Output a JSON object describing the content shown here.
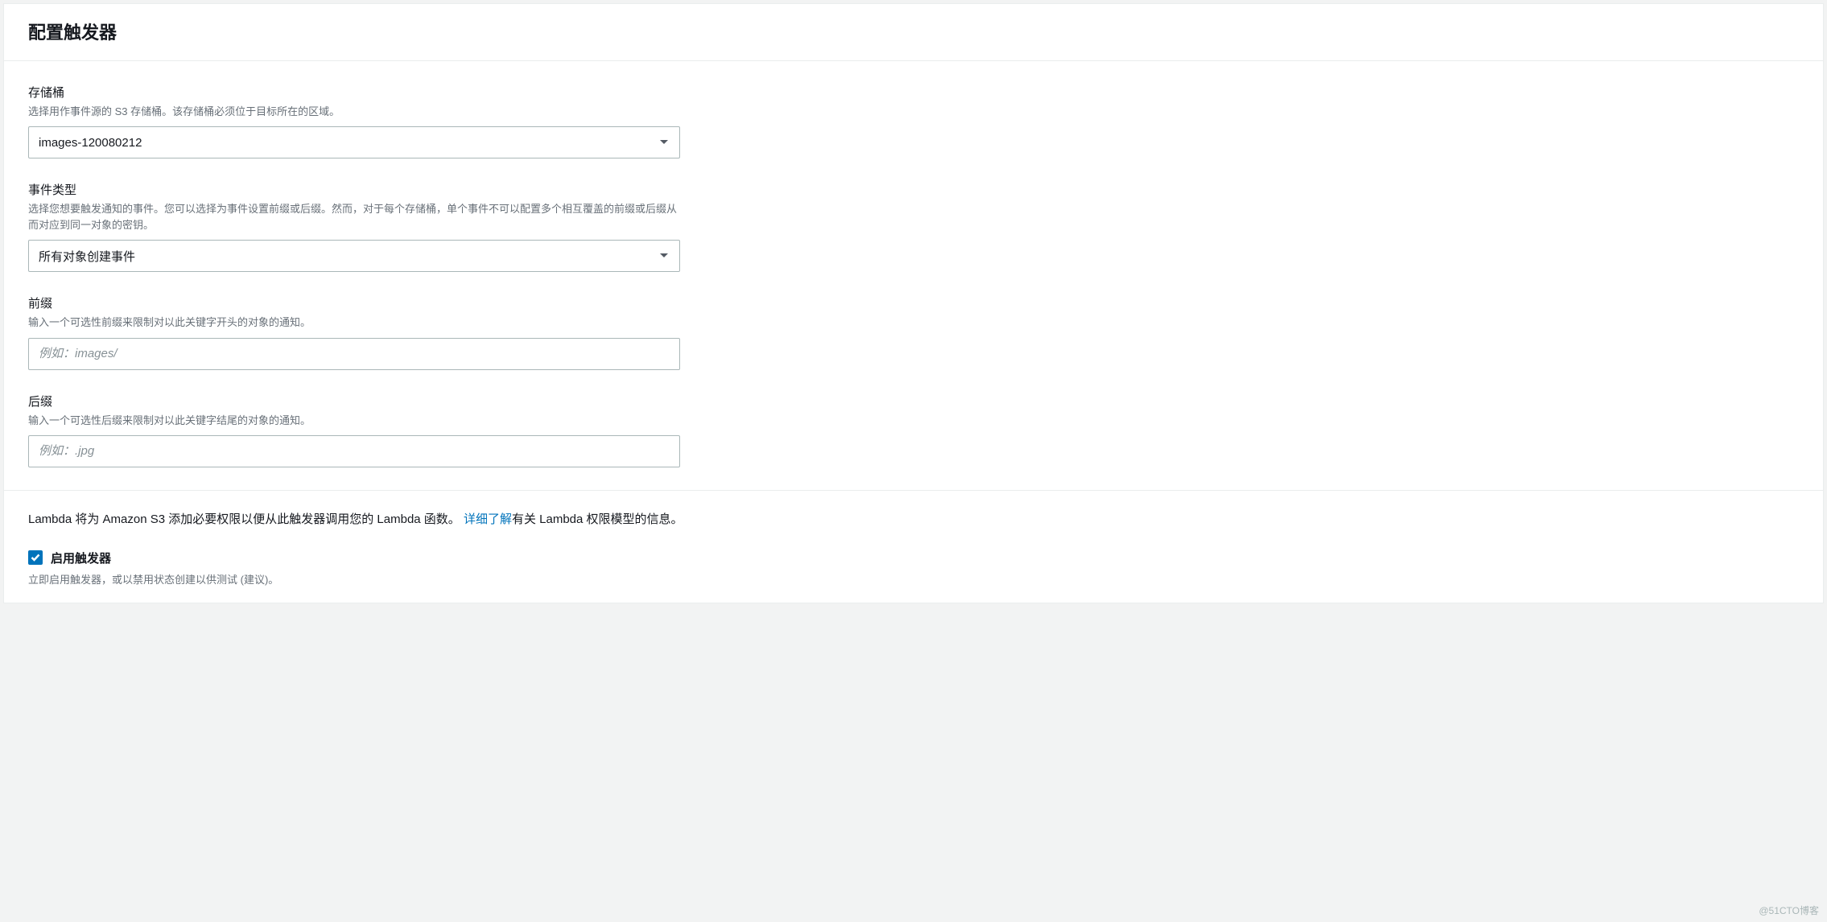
{
  "panel": {
    "title": "配置触发器"
  },
  "bucket": {
    "label": "存储桶",
    "help": "选择用作事件源的 S3 存储桶。该存储桶必须位于目标所在的区域。",
    "value": "images-120080212"
  },
  "eventType": {
    "label": "事件类型",
    "help": "选择您想要触发通知的事件。您可以选择为事件设置前缀或后缀。然而，对于每个存储桶，单个事件不可以配置多个相互覆盖的前缀或后缀从而对应到同一对象的密钥。",
    "value": "所有对象创建事件"
  },
  "prefix": {
    "label": "前缀",
    "help": "输入一个可选性前缀来限制对以此关键字开头的对象的通知。",
    "placeholder": "例如：images/"
  },
  "suffix": {
    "label": "后缀",
    "help": "输入一个可选性后缀来限制对以此关键字结尾的对象的通知。",
    "placeholder": "例如：.jpg"
  },
  "permissionNote": {
    "pre": "Lambda 将为 Amazon S3 添加必要权限以便从此触发器调用您的 Lambda 函数。",
    "link": "详细了解",
    "post": "有关 Lambda 权限模型的信息。"
  },
  "enableTrigger": {
    "label": "启用触发器",
    "help": "立即启用触发器，或以禁用状态创建以供测试 (建议)。",
    "checked": true
  },
  "watermark": "@51CTO博客"
}
